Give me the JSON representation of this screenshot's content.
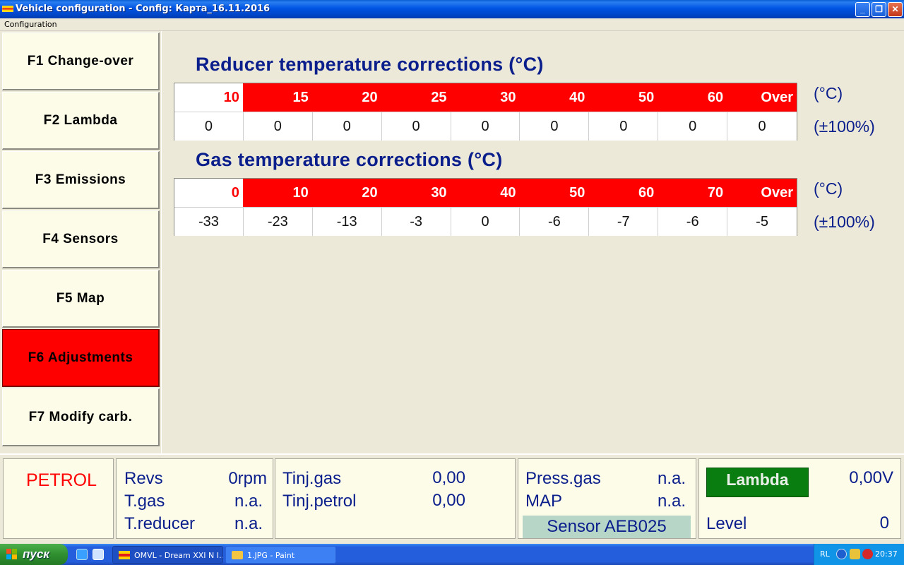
{
  "window": {
    "title": "Vehicle configuration - Config: Карта_16.11.2016"
  },
  "menu": {
    "items": [
      "Configuration"
    ]
  },
  "sidebar": {
    "items": [
      {
        "label": "F1 Change-over"
      },
      {
        "label": "F2 Lambda"
      },
      {
        "label": "F3 Emissions"
      },
      {
        "label": "F4 Sensors"
      },
      {
        "label": "F5 Map"
      },
      {
        "label": "F6 Adjustments"
      },
      {
        "label": "F7 Modify carb."
      }
    ],
    "active": "F6 Adjustments"
  },
  "reducer": {
    "title": "Reducer temperature corrections (°C)",
    "headers": [
      "10",
      "15",
      "20",
      "25",
      "30",
      "40",
      "50",
      "60",
      "Over"
    ],
    "values": [
      "0",
      "0",
      "0",
      "0",
      "0",
      "0",
      "0",
      "0",
      "0"
    ],
    "unit_head": "(°C)",
    "unit_values": "(±100%)"
  },
  "gas": {
    "title": "Gas temperature corrections (°C)",
    "headers": [
      "0",
      "10",
      "20",
      "30",
      "40",
      "50",
      "60",
      "70",
      "Over"
    ],
    "values": [
      "-33",
      "-23",
      "-13",
      "-3",
      "0",
      "-6",
      "-7",
      "-6",
      "-5"
    ],
    "unit_head": "(°C)",
    "unit_values": "(±100%)"
  },
  "status": {
    "mode": "PETROL",
    "revs_label": "Revs",
    "revs_value": "0rpm",
    "tgas_label": "T.gas",
    "tgas_value": "n.a.",
    "treducer_label": "T.reducer",
    "treducer_value": "n.a.",
    "tinj_gas_label": "Tinj.gas",
    "tinj_gas_value": "0,00",
    "tinj_petrol_label": "Tinj.petrol",
    "tinj_petrol_value": "0,00",
    "press_gas_label": "Press.gas",
    "press_gas_value": "n.a.",
    "map_label": "MAP",
    "map_value": "n.a.",
    "sensor": "Sensor AEB025",
    "lambda_label": "Lambda",
    "lambda_value": "0,00V",
    "level_label": "Level",
    "level_value": "0"
  },
  "taskbar": {
    "start_label": "пуск",
    "tasks": [
      {
        "label": "OMVL - Dream XXI N I...",
        "active": true
      },
      {
        "label": "1.JPG - Paint",
        "active": false
      }
    ],
    "tray_lang": "RL",
    "clock": "20:37"
  },
  "colors": {
    "accent_red": "#ff0000",
    "text_blue": "#0a1e8c",
    "panel_cream": "#fdfce8",
    "lambda_green": "#0a7d10",
    "sensor_bg": "#b8d6c8"
  }
}
